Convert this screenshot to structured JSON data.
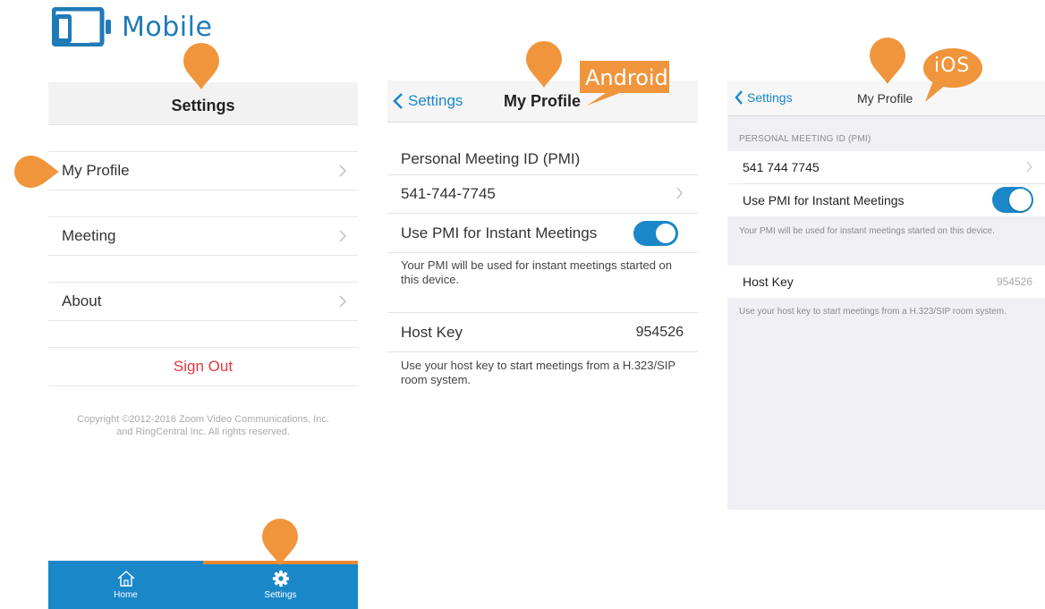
{
  "colors": {
    "brand_blue": "#1a87c9",
    "accent_orange": "#f08a2e",
    "sign_out_red": "#e0383e"
  },
  "header": {
    "logo_icon": "mobile-tablet-icon",
    "title": "Mobile"
  },
  "settings_screen": {
    "title": "Settings",
    "items": [
      {
        "label": "My Profile",
        "icon": "chevron-right-icon"
      },
      {
        "label": "Meeting",
        "icon": "chevron-right-icon"
      },
      {
        "label": "About",
        "icon": "chevron-right-icon"
      }
    ],
    "sign_out": "Sign Out",
    "copyright_line1": "Copyright ©2012-2016 Zoom Video Communications, Inc.",
    "copyright_line2": "and RingCentral Inc. All rights reserved.",
    "tabs": [
      {
        "label": "Home",
        "icon": "home-icon"
      },
      {
        "label": "Settings",
        "icon": "gear-icon"
      }
    ]
  },
  "android_screen": {
    "callout": "Android",
    "back_label": "Settings",
    "title": "My Profile",
    "pmi_label": "Personal Meeting ID (PMI)",
    "pmi_value": "541-744-7745",
    "use_pmi_label": "Use PMI for Instant Meetings",
    "use_pmi_enabled": true,
    "pmi_note": "Your PMI will be used for instant meetings started on this device.",
    "host_key_label": "Host Key",
    "host_key_value": "954526",
    "host_key_note": "Use your host key to start meetings from a H.323/SIP room system."
  },
  "ios_screen": {
    "callout": "iOS",
    "back_label": "Settings",
    "title": "My Profile",
    "section_header": "PERSONAL MEETING ID (PMI)",
    "pmi_value": "541 744 7745",
    "use_pmi_label": "Use PMI for Instant Meetings",
    "use_pmi_enabled": true,
    "pmi_note": "Your PMI will be used for instant meetings started on this device.",
    "host_key_label": "Host Key",
    "host_key_value": "954526",
    "host_key_note": "Use your host key to start meetings from a H.323/SIP room system."
  }
}
